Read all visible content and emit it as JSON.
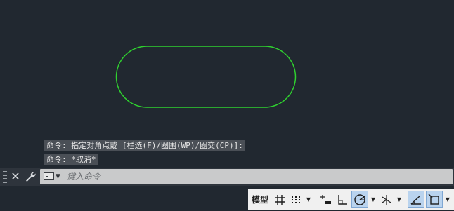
{
  "command_history": [
    "命令: 指定对角点或 [栏选(F)/圈围(WP)/圈交(CP)]:",
    "命令: *取消*"
  ],
  "command_line": {
    "placeholder": "键入命令"
  },
  "status_bar": {
    "model_label": "模型"
  },
  "colors": {
    "background": "#212830",
    "selected_shape": "#2fd12f",
    "active_toggle": "#b9d3ee"
  },
  "icons": [
    "close-icon",
    "wrench-icon",
    "terminal-icon",
    "chevron-down-icon",
    "grid-icon",
    "snap-icon",
    "infer-constraints-icon",
    "ortho-icon",
    "polar-tracking-icon",
    "isodraft-icon",
    "object-snap-tracking-icon",
    "object-snap-icon"
  ]
}
